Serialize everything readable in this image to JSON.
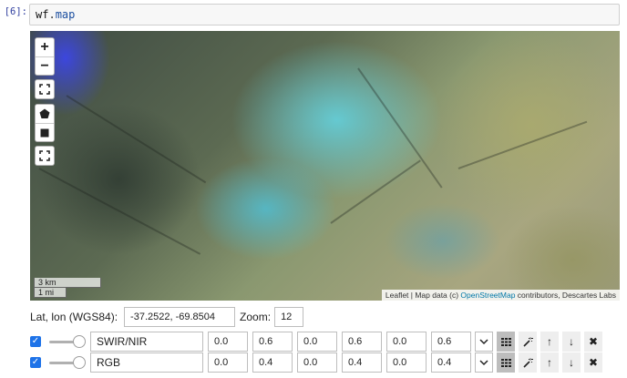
{
  "cell": {
    "prompt": "[6]:",
    "code_object": "wf",
    "code_dot": ".",
    "code_attr": "map"
  },
  "map": {
    "controls": {
      "zoom_in": "+",
      "zoom_out": "−",
      "fullscreen_icon": "fullscreen-icon",
      "draw_polygon_icon": "pentagon-icon",
      "draw_rectangle_icon": "square-icon",
      "fit_icon": "fit-bounds-icon"
    },
    "scale": {
      "metric": "3 km",
      "imperial": "1 mi"
    },
    "attribution": {
      "prefix": "Leaflet | Map data (c) ",
      "link": "OpenStreetMap",
      "suffix": " contributors, Descartes Labs"
    }
  },
  "coords": {
    "label": "Lat, lon (WGS84):",
    "value": "-37.2522, -69.8504",
    "zoom_label": "Zoom:",
    "zoom_value": "12"
  },
  "layers": [
    {
      "checked": true,
      "name": "SWIR/NIR",
      "values": [
        "0.0",
        "0.6",
        "0.0",
        "0.6",
        "0.0",
        "0.6"
      ]
    },
    {
      "checked": true,
      "name": "RGB",
      "values": [
        "0.0",
        "0.4",
        "0.0",
        "0.4",
        "0.0",
        "0.4"
      ]
    }
  ],
  "layer_tools": {
    "dropdown": "chevron-down-icon",
    "colormap": "grid-icon",
    "autoscale": "magic-wand-icon",
    "move_up": "↑",
    "move_down": "↓",
    "remove": "✖"
  }
}
